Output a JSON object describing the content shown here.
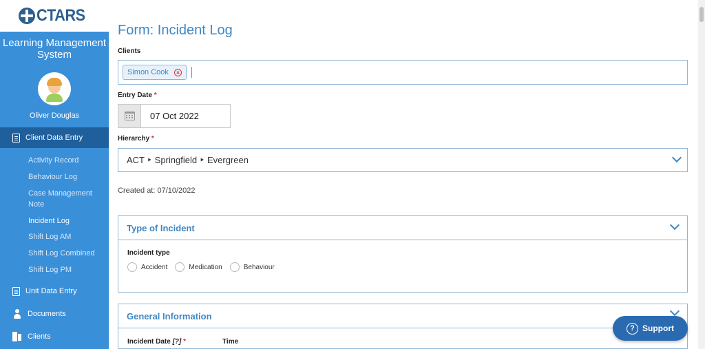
{
  "brand": {
    "logo_text": "CTARS",
    "app_title": "Learning Management System"
  },
  "user": {
    "name": "Oliver Douglas"
  },
  "sidebar": {
    "client_data_entry": "Client Data Entry",
    "sub_items": [
      "Activity Record",
      "Behaviour Log",
      "Case Management Note",
      "Incident Log",
      "Shift Log AM",
      "Shift Log Combined",
      "Shift Log PM"
    ],
    "unit_data_entry": "Unit Data Entry",
    "documents": "Documents",
    "clients": "Clients"
  },
  "form": {
    "title": "Form: Incident Log",
    "clients_label": "Clients",
    "client_chip": "Simon Cook",
    "entry_date_label": "Entry Date",
    "entry_date_value": "07 Oct 2022",
    "hierarchy_label": "Hierarchy",
    "hierarchy_value": "ACT ‣ Springfield ‣ Evergreen",
    "created_at": "Created at: 07/10/2022",
    "required_mark": "*"
  },
  "type_of_incident": {
    "title": "Type of Incident",
    "incident_type_label": "Incident type",
    "options": [
      "Accident",
      "Medication",
      "Behaviour"
    ]
  },
  "general_information": {
    "title": "General Information",
    "incident_date_label": "Incident Date",
    "incident_date_hint": "[?]",
    "time_label": "Time"
  },
  "support": {
    "label": "Support",
    "help_glyph": "?"
  },
  "colors": {
    "sidebar": "#3a8fd9",
    "sidebar_active": "#1f5f9c",
    "accent": "#3f87c4",
    "required": "#d9302c",
    "support": "#2a6ab0"
  }
}
